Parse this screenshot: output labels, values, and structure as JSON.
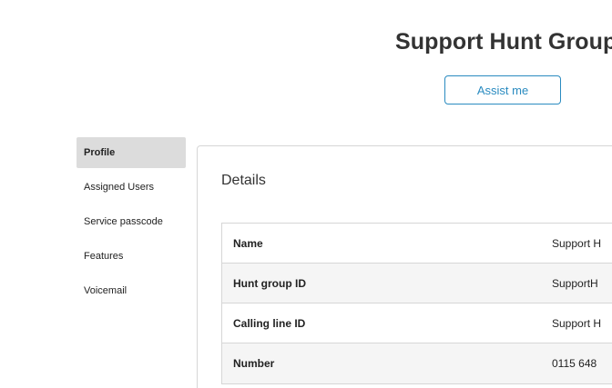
{
  "header": {
    "title": "Support Hunt Group",
    "assist_label": "Assist me"
  },
  "sidebar": {
    "items": [
      {
        "label": "Profile",
        "active": true
      },
      {
        "label": "Assigned Users",
        "active": false
      },
      {
        "label": "Service passcode",
        "active": false
      },
      {
        "label": "Features",
        "active": false
      },
      {
        "label": "Voicemail",
        "active": false
      }
    ]
  },
  "details": {
    "title": "Details",
    "rows": [
      {
        "label": "Name",
        "value": "Support H"
      },
      {
        "label": "Hunt group ID",
        "value": "SupportH"
      },
      {
        "label": "Calling line ID",
        "value": "Support H"
      },
      {
        "label": "Number",
        "value": "0115 648"
      }
    ]
  },
  "colors": {
    "accent": "#2a8bc0",
    "active_nav_bg": "#dcdcdc",
    "alt_row_bg": "#f5f5f5",
    "border": "#d6d6d6"
  }
}
